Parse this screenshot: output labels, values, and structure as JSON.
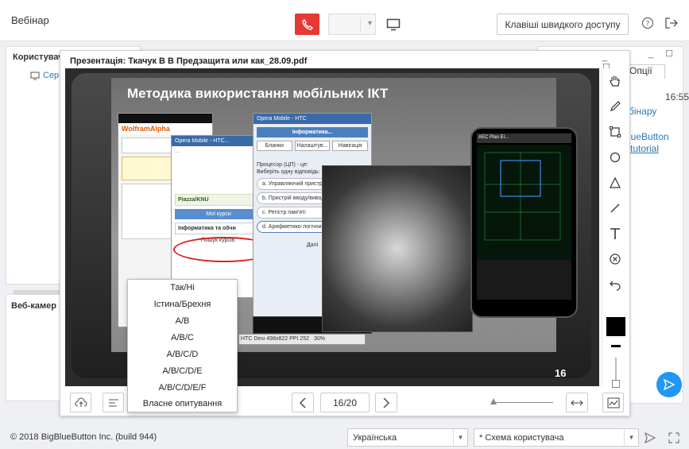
{
  "header": {
    "title": "Вебінар",
    "shortcuts_label": "Клавіші швидкого доступу"
  },
  "users_panel": {
    "title": "Користувач",
    "first_user": "Сер"
  },
  "webcam_panel": {
    "title": "Веб-камер"
  },
  "chat_panel": {
    "tab_label": "Опції",
    "time": "16:55",
    "line1": "бінару",
    "line2": "lueButton",
    "line3": "tutorial"
  },
  "presentation": {
    "title": "Презентація: Ткачук В В Предзащита или как_28.09.pdf",
    "slide_heading": "Методика використання мобільних ІКТ",
    "slide_number": "16",
    "page_indicator": "16/20",
    "mock_texts": {
      "wolfram": "WolframAlpha",
      "opera1": "Opera Mobile - HTC...",
      "opera2": "Opera Mobile - HTC",
      "informatyka": "Інформатика...",
      "piazza": "Piazza/KNU",
      "my_courses": "Мої курси",
      "informatika_obch": "Інформатика та обчи",
      "search_courses": "Пошук курсів:",
      "aec": "AEC Plan El...",
      "btn_blanky": "Бланки",
      "btn_nalasht": "Налаштув...",
      "btn_navig": "Навігація",
      "q_title": "Процесор (ЦП) - це:",
      "q_select": "Виберіть одну відповідь:",
      "opt_a": "a. Управляючий пристрій",
      "opt_b": "b. Пристрій вводу/виводу інформації",
      "opt_c": "c. Регістр пам'яті",
      "opt_d": "d. Арифметико-логічний пристрій",
      "next_btn": "Далі",
      "htc": "HTC Desi 498x822 PPI 252",
      "zoom30": "30%"
    }
  },
  "poll_menu": {
    "items": [
      "Так/Ні",
      "Істина/Брехня",
      "A/B",
      "A/B/C",
      "A/B/C/D",
      "A/B/C/D/E",
      "A/B/C/D/E/F",
      "Власне опитування"
    ]
  },
  "footer": {
    "copyright": "© 2018 BigBlueButton Inc. (build 944)",
    "language": "Українська",
    "layout": "* Схема користувача"
  },
  "colors": {
    "phone_button": "#e53935",
    "send_button": "#2196f3",
    "link": "#2a7ab8"
  }
}
